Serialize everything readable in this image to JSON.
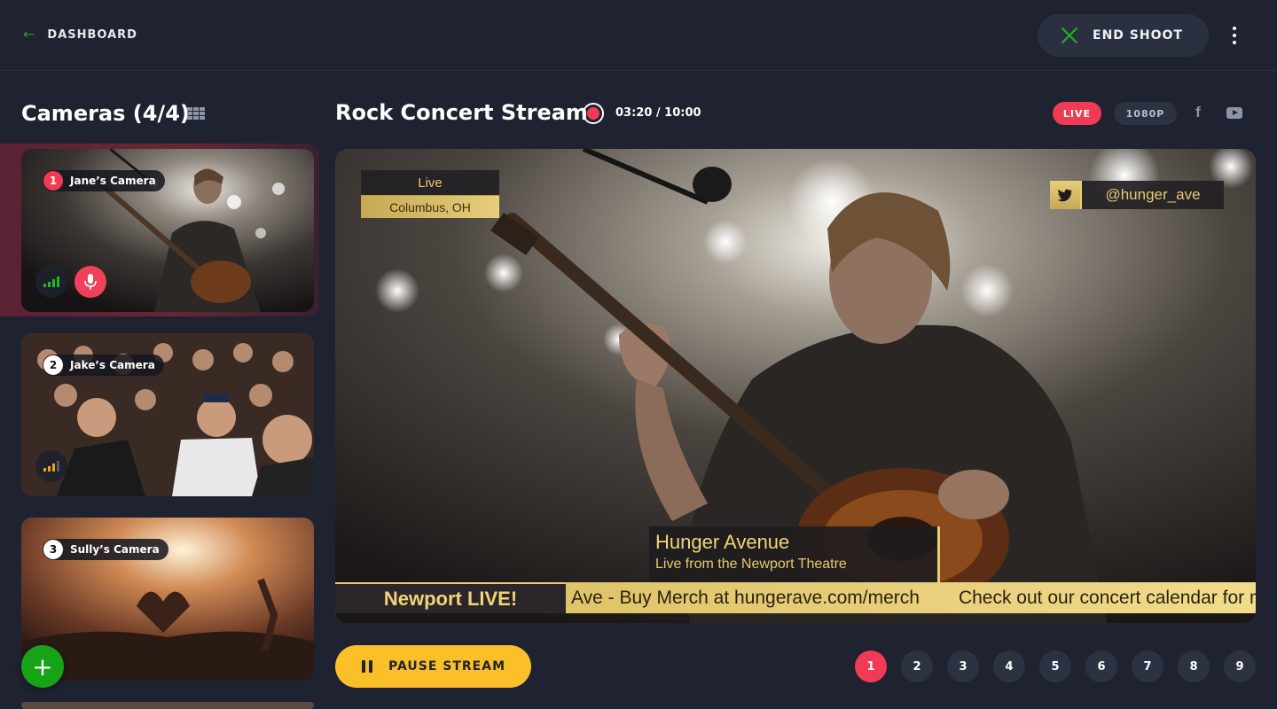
{
  "topbar": {
    "back_label": "DASHBOARD",
    "end_shoot_label": "END SHOOT"
  },
  "sidebar": {
    "title": "Cameras (4/4)",
    "cameras": [
      {
        "number": "1",
        "name": "Jane’s Camera",
        "active": true,
        "signal": "strong",
        "mic": "on"
      },
      {
        "number": "2",
        "name": "Jake’s Camera",
        "active": false,
        "signal": "medium"
      },
      {
        "number": "3",
        "name": "Sully’s Camera",
        "active": false,
        "signal": "unknown"
      }
    ],
    "add_label": "+"
  },
  "stream": {
    "title": "Rock Concert Stream",
    "timer": "03:20 / 10:00",
    "live_badge": "LIVE",
    "resolution": "1080P",
    "social": [
      "facebook-icon",
      "youtube-icon"
    ]
  },
  "overlay": {
    "status": "Live",
    "location": "Columbus, OH",
    "twitter_handle": "@hunger_ave",
    "band_name": "Hunger Avenue",
    "venue": "Live from the Newport Theatre",
    "ticker_brand": "Newport LIVE!",
    "ticker_items": [
      "Ave - Buy Merch at  hungerave.com/merch",
      "Check out our concert calendar for mo"
    ]
  },
  "controls": {
    "pause_label": "PAUSE STREAM",
    "pages": [
      "1",
      "2",
      "3",
      "4",
      "5",
      "6",
      "7",
      "8",
      "9"
    ],
    "current_page": "1"
  },
  "colors": {
    "background": "#1f2230",
    "accent_red": "#ef3b54",
    "accent_yellow": "#fbbf2a",
    "accent_green": "#17a317",
    "overlay_gold": "#e7ce7a"
  }
}
